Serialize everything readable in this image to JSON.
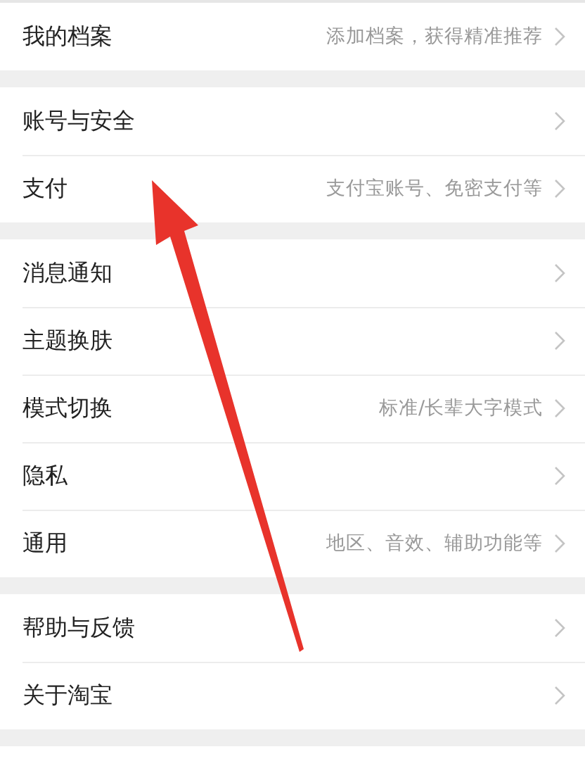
{
  "sections": [
    {
      "rows": [
        {
          "label": "我的档案",
          "hint": "添加档案，获得精准推荐"
        }
      ]
    },
    {
      "rows": [
        {
          "label": "账号与安全"
        },
        {
          "label": "支付",
          "hint": "支付宝账号、免密支付等"
        }
      ]
    },
    {
      "rows": [
        {
          "label": "消息通知"
        },
        {
          "label": "主题换肤"
        },
        {
          "label": "模式切换",
          "hint": "标准/长辈大字模式"
        },
        {
          "label": "隐私"
        },
        {
          "label": "通用",
          "hint": "地区、音效、辅助功能等"
        }
      ]
    },
    {
      "rows": [
        {
          "label": "帮助与反馈"
        },
        {
          "label": "关于淘宝"
        }
      ]
    }
  ]
}
